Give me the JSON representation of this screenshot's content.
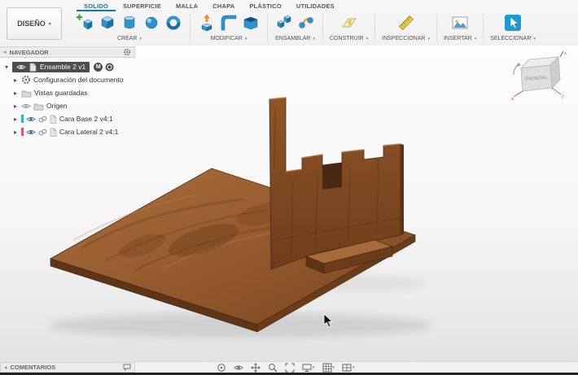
{
  "ui": {
    "caret": "▾",
    "expander_open": "▾",
    "expander_closed": "▸",
    "collapse_arrow": "◂"
  },
  "topbar": {
    "design_button": "DISEÑO",
    "tabs": [
      {
        "label": "SOLIDO",
        "active": true
      },
      {
        "label": "SUPERFICIE"
      },
      {
        "label": "MALLA"
      },
      {
        "label": "CHAPA"
      },
      {
        "label": "PLÁSTICO"
      },
      {
        "label": "UTILIDADES"
      }
    ],
    "groups": [
      {
        "label": "CREAR"
      },
      {
        "label": "MODIFICAR"
      },
      {
        "label": "ENSAMBLAR"
      },
      {
        "label": "CONSTRUIR"
      },
      {
        "label": "INSPECCIONAR"
      },
      {
        "label": "INSERTAR"
      },
      {
        "label": "SELECCIONAR"
      }
    ]
  },
  "navigator": {
    "title": "NAVEGADOR",
    "items": [
      {
        "label": "Ensamble 2 v1",
        "selected": true,
        "badge": "M"
      },
      {
        "label": "Configuración del documento"
      },
      {
        "label": "Vistas guardadas"
      },
      {
        "label": "Origen"
      },
      {
        "label": "Cara Base 2 v4:1",
        "marker_style": "background:#35b0c9"
      },
      {
        "label": "Cara Lateral 2 v4:1",
        "marker_style": "background:#e0566b"
      }
    ]
  },
  "viewcube": {
    "front_face": "FRONTAL",
    "axis_x": "x",
    "axis_y": "y",
    "axis_z": "z"
  },
  "bottom": {
    "comments_title": "COMENTARIOS"
  },
  "colors": {
    "accent_blue": "#0a79b8",
    "selection_dark": "#4c4c4c",
    "wood_light": "#a76b3a",
    "wood_mid": "#8a5029",
    "wood_dark": "#5c3315",
    "canvas_top": "#fdfdfd",
    "canvas_bottom": "#e3e3e3"
  }
}
